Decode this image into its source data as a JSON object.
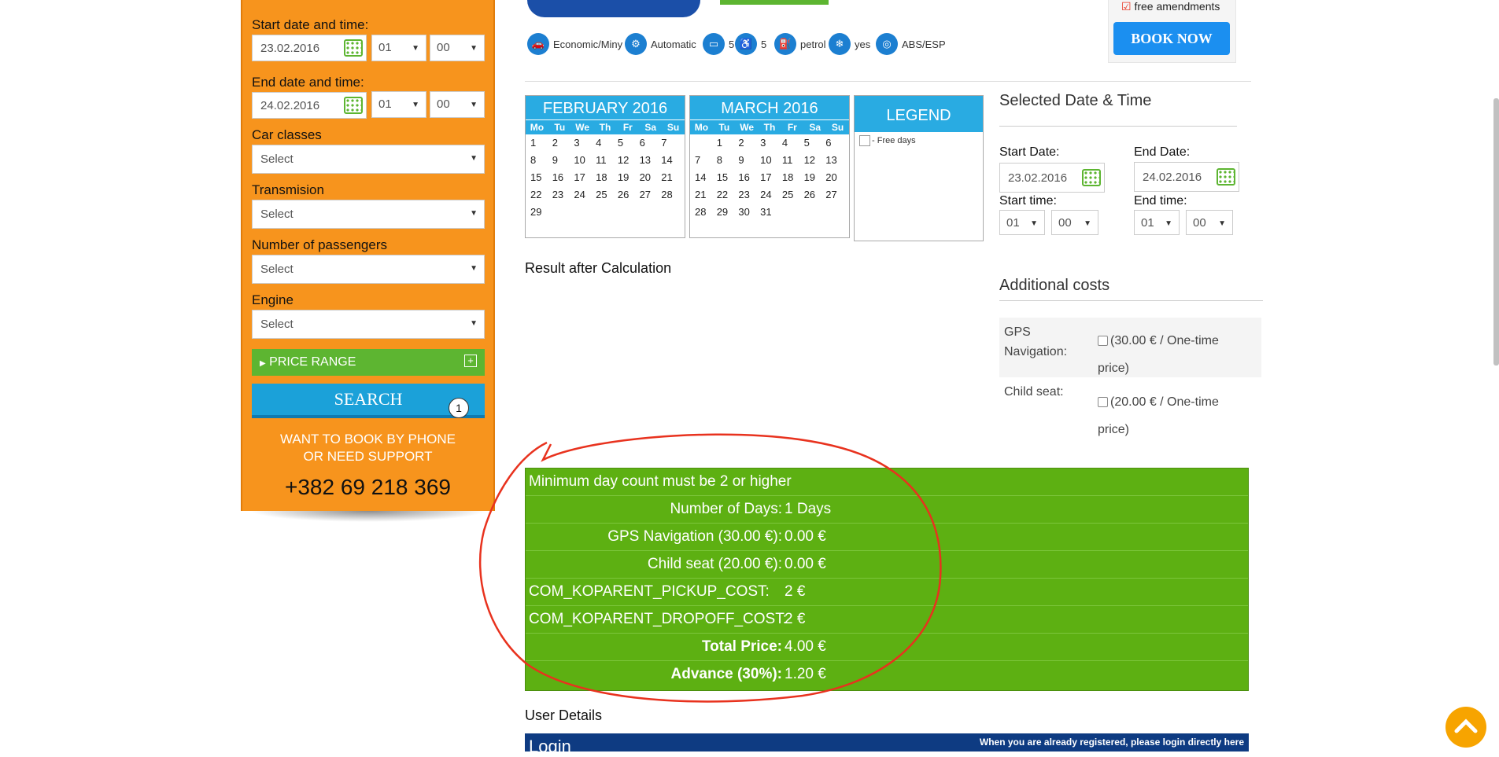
{
  "sidebar": {
    "start_label": "Start date and time:",
    "start_date": "23.02.2016",
    "start_hour": "01",
    "start_min": "00",
    "end_label": "End date and time:",
    "end_date": "24.02.2016",
    "end_hour": "01",
    "end_min": "00",
    "car_classes_label": "Car classes",
    "car_classes_value": "Select",
    "transmission_label": "Transmision",
    "transmission_value": "Select",
    "passengers_label": "Number of passengers",
    "passengers_value": "Select",
    "engine_label": "Engine",
    "engine_value": "Select",
    "price_range": "PRICE RANGE",
    "search": "SEARCH",
    "search_badge": "1",
    "support_line1": "WANT TO BOOK BY PHONE",
    "support_line2": "OR NEED SUPPORT",
    "phone": "+382 69 218 369"
  },
  "booking": {
    "free_amendments": "free amendments",
    "book_now": "BOOK NOW"
  },
  "features": [
    {
      "icon": "car-class-icon",
      "label": "Economic/Miny"
    },
    {
      "icon": "transmission-icon",
      "label": "Automatic"
    },
    {
      "icon": "doors-icon",
      "label": "5"
    },
    {
      "icon": "seats-icon",
      "label": "5"
    },
    {
      "icon": "fuel-icon",
      "label": "petrol"
    },
    {
      "icon": "aircon-icon",
      "label": "yes"
    },
    {
      "icon": "abs-icon",
      "label": "ABS/ESP"
    }
  ],
  "calendars": {
    "feb_title": "FEBRUARY 2016",
    "mar_title": "MARCH 2016",
    "weekdays": [
      "Mo",
      "Tu",
      "We",
      "Th",
      "Fr",
      "Sa",
      "Su"
    ],
    "feb_days": [
      "1",
      "2",
      "3",
      "4",
      "5",
      "6",
      "7",
      "8",
      "9",
      "10",
      "11",
      "12",
      "13",
      "14",
      "15",
      "16",
      "17",
      "18",
      "19",
      "20",
      "21",
      "22",
      "23",
      "24",
      "25",
      "26",
      "27",
      "28",
      "29"
    ],
    "mar_days": [
      "",
      "1",
      "2",
      "3",
      "4",
      "5",
      "6",
      "7",
      "8",
      "9",
      "10",
      "11",
      "12",
      "13",
      "14",
      "15",
      "16",
      "17",
      "18",
      "19",
      "20",
      "21",
      "22",
      "23",
      "24",
      "25",
      "26",
      "27",
      "28",
      "29",
      "30",
      "31"
    ],
    "legend_title": "LEGEND",
    "legend_free": "- Free days"
  },
  "selected": {
    "title": "Selected Date & Time",
    "start_date_label": "Start Date:",
    "start_date": "23.02.2016",
    "end_date_label": "End Date:",
    "end_date": "24.02.2016",
    "start_time_label": "Start time:",
    "start_hour": "01",
    "start_min": "00",
    "end_time_label": "End time:",
    "end_hour": "01",
    "end_min": "00"
  },
  "result_title": "Result after Calculation",
  "additional": {
    "title": "Additional costs",
    "gps_label_1": "GPS",
    "gps_label_2": "Navigation:",
    "gps_price_1": "(30.00 € / One-time",
    "gps_price_2": "price)",
    "child_label": "Child seat:",
    "child_price_1": "(20.00 € / One-time",
    "child_price_2": "price)"
  },
  "result": {
    "warning": "Minimum day count must be 2 or higher",
    "days_label": "Number of Days:",
    "days_value": "1 Days",
    "gps_label": "GPS Navigation (30.00 €):",
    "gps_value": "0.00 €",
    "child_label": "Child seat (20.00 €):",
    "child_value": "0.00 €",
    "pickup_label": "COM_KOPARENT_PICKUP_COST:",
    "pickup_value": "2 €",
    "dropoff_label": "COM_KOPARENT_DROPOFF_COST:",
    "dropoff_value": "2 €",
    "total_label": "Total Price:",
    "total_value": "4.00 €",
    "advance_label": "Advance (30%):",
    "advance_value": "1.20 €"
  },
  "user_details": {
    "title": "User Details",
    "login_title": "Login",
    "login_hint": "When you are already registered, please login directly here"
  },
  "colors": {
    "sidebar_orange": "#f7941d",
    "accent_blue": "#1ba1d9",
    "result_green": "#5db012",
    "annotation_red": "#e8321e"
  }
}
